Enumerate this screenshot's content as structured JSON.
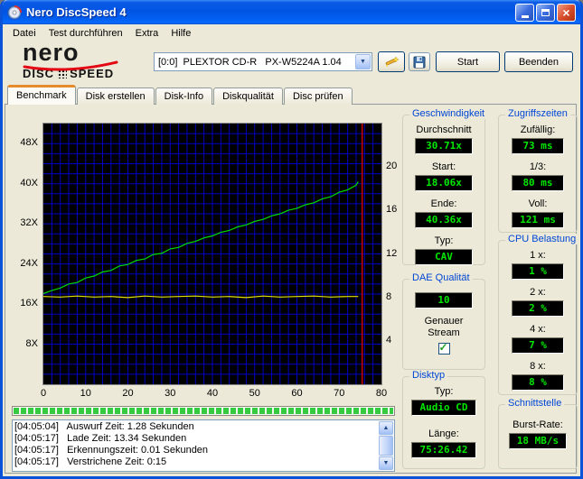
{
  "window": {
    "title": "Nero DiscSpeed 4",
    "menu": [
      "Datei",
      "Test durchführen",
      "Extra",
      "Hilfe"
    ],
    "drive_combo": "[0:0]  PLEXTOR CD-R   PX-W5224A 1.04",
    "start_label": "Start",
    "quit_label": "Beenden"
  },
  "branding": {
    "nero": "nero",
    "disc": "DISC",
    "speed": "SPEED"
  },
  "tabs": [
    {
      "label": "Benchmark",
      "active": true
    },
    {
      "label": "Disk erstellen",
      "active": false
    },
    {
      "label": "Disk-Info",
      "active": false
    },
    {
      "label": "Diskqualität",
      "active": false
    },
    {
      "label": "Disc prüfen",
      "active": false
    }
  ],
  "chart_data": {
    "type": "line",
    "title": "",
    "x_axis": {
      "min": 0,
      "max": 80,
      "grid_step": 2,
      "ticks": [
        "0",
        "10",
        "20",
        "30",
        "40",
        "50",
        "60",
        "70",
        "80"
      ]
    },
    "y_axis_left": {
      "min": 0,
      "max": 52,
      "grid_step": 2,
      "ticks": [
        {
          "v": 48,
          "label": "48X"
        },
        {
          "v": 40,
          "label": "40X"
        },
        {
          "v": 32,
          "label": "32X"
        },
        {
          "v": 24,
          "label": "24X"
        },
        {
          "v": 16,
          "label": "16X"
        },
        {
          "v": 8,
          "label": "8X"
        }
      ]
    },
    "y_axis_right": {
      "min": 0,
      "max": 24,
      "ticks": [
        {
          "v": 20,
          "label": "20"
        },
        {
          "v": 16,
          "label": "16"
        },
        {
          "v": 12,
          "label": "12"
        },
        {
          "v": 8,
          "label": "8"
        },
        {
          "v": 4,
          "label": "4"
        }
      ]
    },
    "colors": {
      "background": "#000000",
      "grid": "#0000C4",
      "capacity": "#CC0000"
    },
    "capacity_marker": 75.44,
    "series": [
      {
        "name": "read-speed",
        "color": "#00DC00",
        "points": [
          [
            0,
            18.1
          ],
          [
            2,
            18.7
          ],
          [
            4,
            19.2
          ],
          [
            6,
            20.0
          ],
          [
            8,
            20.3
          ],
          [
            10,
            21.2
          ],
          [
            12,
            21.6
          ],
          [
            14,
            22.4
          ],
          [
            16,
            22.7
          ],
          [
            18,
            23.6
          ],
          [
            20,
            23.9
          ],
          [
            22,
            24.7
          ],
          [
            24,
            25.0
          ],
          [
            26,
            25.9
          ],
          [
            28,
            26.1
          ],
          [
            30,
            27.0
          ],
          [
            32,
            27.3
          ],
          [
            34,
            28.1
          ],
          [
            36,
            28.5
          ],
          [
            38,
            29.2
          ],
          [
            40,
            29.6
          ],
          [
            42,
            30.3
          ],
          [
            44,
            30.7
          ],
          [
            46,
            31.4
          ],
          [
            48,
            31.8
          ],
          [
            50,
            32.5
          ],
          [
            52,
            32.9
          ],
          [
            54,
            33.6
          ],
          [
            56,
            34.0
          ],
          [
            58,
            34.7
          ],
          [
            60,
            35.1
          ],
          [
            62,
            35.8
          ],
          [
            64,
            36.2
          ],
          [
            66,
            37.0
          ],
          [
            68,
            37.4
          ],
          [
            70,
            38.3
          ],
          [
            72,
            38.8
          ],
          [
            74,
            39.7
          ],
          [
            74.5,
            40.4
          ]
        ]
      },
      {
        "name": "rotation-speed",
        "color": "#E2E200",
        "points": [
          [
            0,
            17.5
          ],
          [
            4,
            17.4
          ],
          [
            8,
            17.6
          ],
          [
            12,
            17.4
          ],
          [
            16,
            17.5
          ],
          [
            20,
            17.3
          ],
          [
            24,
            17.6
          ],
          [
            28,
            17.4
          ],
          [
            32,
            17.5
          ],
          [
            36,
            17.6
          ],
          [
            40,
            17.4
          ],
          [
            44,
            17.5
          ],
          [
            48,
            17.3
          ],
          [
            52,
            17.6
          ],
          [
            56,
            17.4
          ],
          [
            60,
            17.5
          ],
          [
            64,
            17.6
          ],
          [
            68,
            17.4
          ],
          [
            72,
            17.5
          ],
          [
            74.5,
            17.5
          ]
        ]
      }
    ]
  },
  "progress": {
    "value_percent": 100
  },
  "log": {
    "lines": [
      "[04:05:04]   Auswurf Zeit: 1.28 Sekunden",
      "[04:05:17]   Lade Zeit: 13.34 Sekunden",
      "[04:05:17]   Erkennungszeit: 0.01 Sekunden",
      "[04:05:17]   Verstrichene Zeit: 0:15"
    ]
  },
  "panels": {
    "speed": {
      "title": "Geschwindigkeit",
      "avg_label": "Durchschnitt",
      "avg": "30.71x",
      "start_label": "Start:",
      "start": "18.06x",
      "end_label": "Ende:",
      "end": "40.36x",
      "type_label": "Typ:",
      "type": "CAV"
    },
    "access": {
      "title": "Zugriffszeiten",
      "random_label": "Zufällig:",
      "random": "73 ms",
      "third_label": "1/3:",
      "third": "80 ms",
      "full_label": "Voll:",
      "full": "121 ms"
    },
    "cpu": {
      "title": "CPU Belastung",
      "rows": [
        {
          "label": "1 x:",
          "value": "1 %"
        },
        {
          "label": "2 x:",
          "value": "2 %"
        },
        {
          "label": "4 x:",
          "value": "7 %"
        },
        {
          "label": "8 x:",
          "value": "8 %"
        }
      ]
    },
    "dae": {
      "title": "DAE Qualität",
      "score": "10",
      "stream_label": "Genauer Stream",
      "checked": true
    },
    "disc": {
      "title": "Disktyp",
      "type_label": "Typ:",
      "type": "Audio CD",
      "length_label": "Länge:",
      "length": "75:26.42"
    },
    "interface": {
      "title": "Schnittstelle",
      "burst_label": "Burst-Rate:",
      "burst": "18 MB/s"
    }
  }
}
